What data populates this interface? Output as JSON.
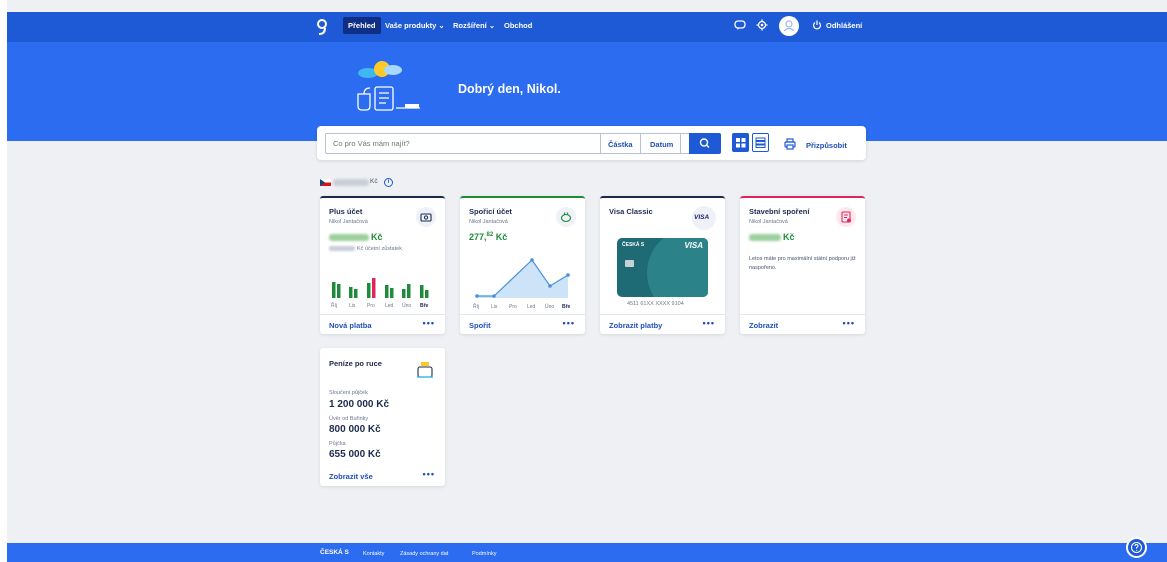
{
  "nav": {
    "items": [
      {
        "label": "Přehled",
        "active": true
      },
      {
        "label": "Vaše produkty ⌄",
        "active": false
      },
      {
        "label": "Rozšíření ⌄",
        "active": false
      },
      {
        "label": "Obchod",
        "active": false
      }
    ],
    "logout_label": "Odhlášení",
    "icons": [
      "chat-icon",
      "gear-icon",
      "user-icon",
      "power-icon"
    ]
  },
  "hero": {
    "greeting": "Dobrý den, Nikol."
  },
  "search": {
    "placeholder": "Co pro Vás mám najít?",
    "amount_label": "Částka",
    "date_label": "Datum",
    "customize_label": "Přizpůsobit"
  },
  "balance": {
    "currency": "Kč"
  },
  "cards": [
    {
      "title": "Plus účet",
      "owner": "Nikol Jantačová",
      "currency": "Kč",
      "sub_label": "Kč účetní zůstatek",
      "footer_link": "Nová platba",
      "more": "•••",
      "accent": "#1c2a4d",
      "months": [
        "Říj",
        "Lis",
        "Pro",
        "Led",
        "Úno",
        "Bře"
      ]
    },
    {
      "title": "Spořicí účet",
      "owner": "Nikol Jantačová",
      "amount_main": "277,",
      "amount_sup": "82",
      "amount_currency": " Kč",
      "footer_link": "Spořit",
      "more": "•••",
      "accent": "#1f8a3a",
      "months": [
        "Říj",
        "Lis",
        "Pro",
        "Led",
        "Úno",
        "Bře"
      ]
    },
    {
      "title": "Visa Classic",
      "card_brand": "VISA",
      "bank_mark": "ČESKÁ S",
      "card_number": "4511 61XX XXXX 9104",
      "footer_link": "Zobrazit platby",
      "more": "•••",
      "accent": "#1c2a4d"
    },
    {
      "title": "Stavební spoření",
      "owner": "Nikol Jantačová",
      "currency": "Kč",
      "note": "Letos máte pro maximální státní podporu již naspořeno.",
      "footer_link": "Zobrazit",
      "more": "•••",
      "accent": "#e0245e"
    },
    {
      "title": "Peníze po ruce",
      "items": [
        {
          "label": "Sloučení půjček",
          "value": "1 200 000 Kč"
        },
        {
          "label": "Úvěr od Buřinky",
          "value": "800 000 Kč"
        },
        {
          "label": "Půjčka",
          "value": "655 000 Kč"
        }
      ],
      "footer_link": "Zobrazit vše",
      "more": "•••"
    }
  ],
  "footer": {
    "logo": "ČESKÁ S",
    "links": [
      "Kontakty",
      "Zásady ochrany dat",
      "Podmínky"
    ]
  },
  "colors": {
    "nav_bg": "#1f5ad6",
    "hero_bg": "#2b6cf0",
    "green": "#1f8a3a",
    "red": "#e0245e"
  }
}
